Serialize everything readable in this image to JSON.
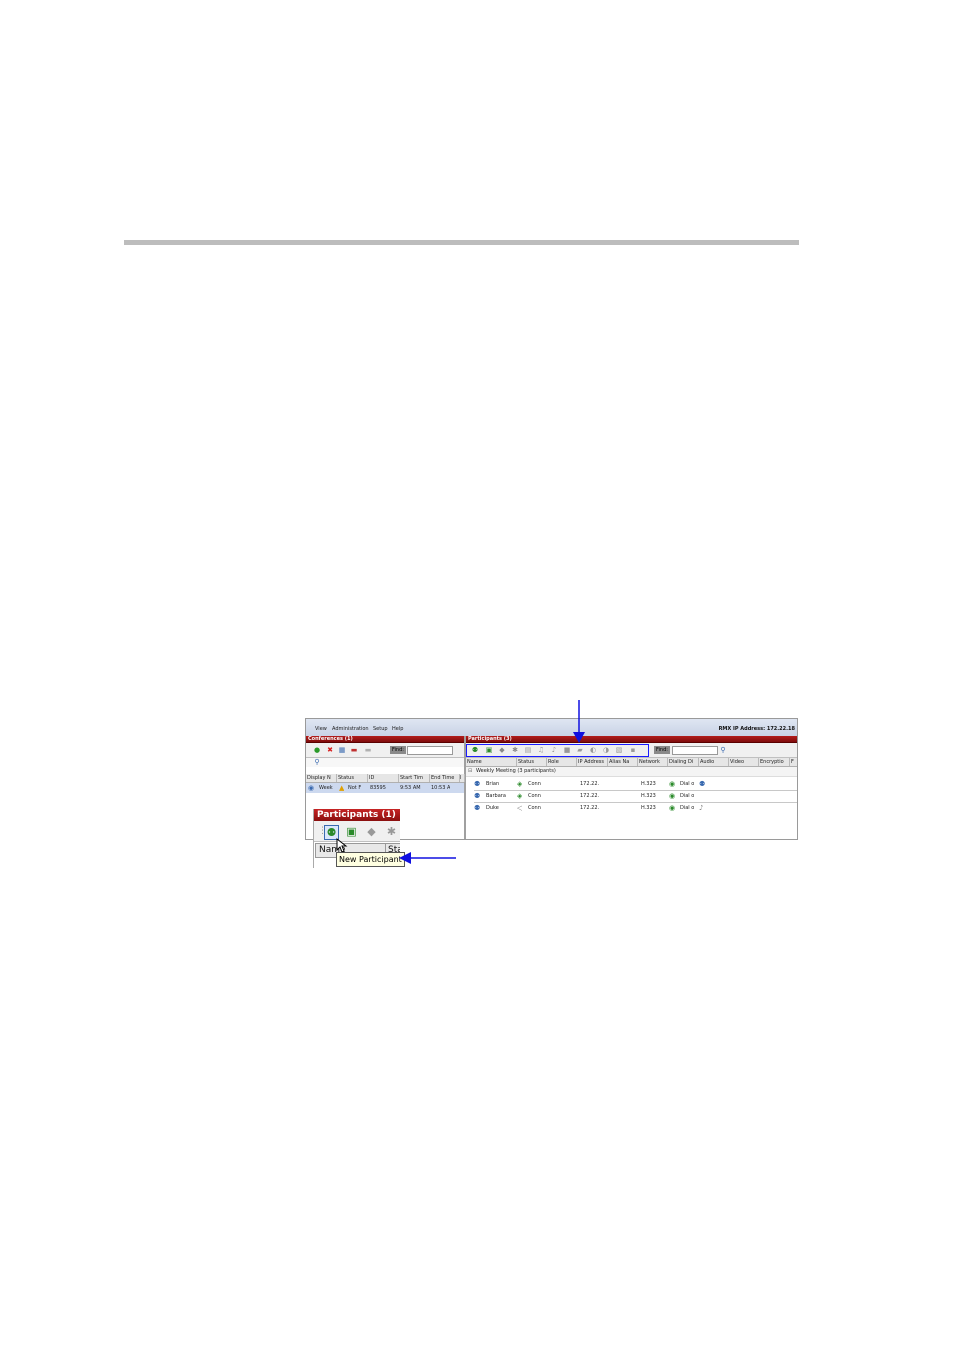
{
  "menu": {
    "items": [
      "View",
      "Administration",
      "Setup",
      "Help"
    ],
    "ip_label": "RMX IP Address: 172.22.18"
  },
  "conferences": {
    "title": "Conferences (1)",
    "find_label": "Find:",
    "columns": [
      "Display N",
      "Status",
      "ID",
      "Start Tim",
      "End Time",
      "I"
    ],
    "row": {
      "name": "Week",
      "status": "Not F",
      "id": "83595",
      "start": "9:53 AM",
      "end": "10:53 A"
    }
  },
  "participants": {
    "title": "Participants (3)",
    "find_label": "Find:",
    "columns": [
      "Name",
      "Status",
      "Role",
      "IP Address",
      "Alias Na",
      "Network",
      "Dialing Di",
      "Audio",
      "Video",
      "Encryptio",
      "F"
    ],
    "group_label": "Weekly Meeting (3  participants)",
    "rows": [
      {
        "name": "Brian",
        "status": "Conn",
        "ip": "172.22.",
        "network": "H.323",
        "dial": "Dial o"
      },
      {
        "name": "Barbara",
        "status": "Conn",
        "ip": "172.22.",
        "network": "H.323",
        "dial": "Dial o"
      },
      {
        "name": "Duke",
        "status": "Conn",
        "ip": "172.22.",
        "network": "H.323",
        "dial": "Dial o"
      }
    ]
  },
  "popup": {
    "title": "Participants (1)",
    "columns": [
      "Name",
      "Sta"
    ],
    "tooltip": "New Participant"
  },
  "colors": {
    "title_red": "#a51a1a",
    "highlight_blue": "#1a1aff",
    "arrow_blue": "#1010e0",
    "rule_gray": "#bdbdbd"
  }
}
